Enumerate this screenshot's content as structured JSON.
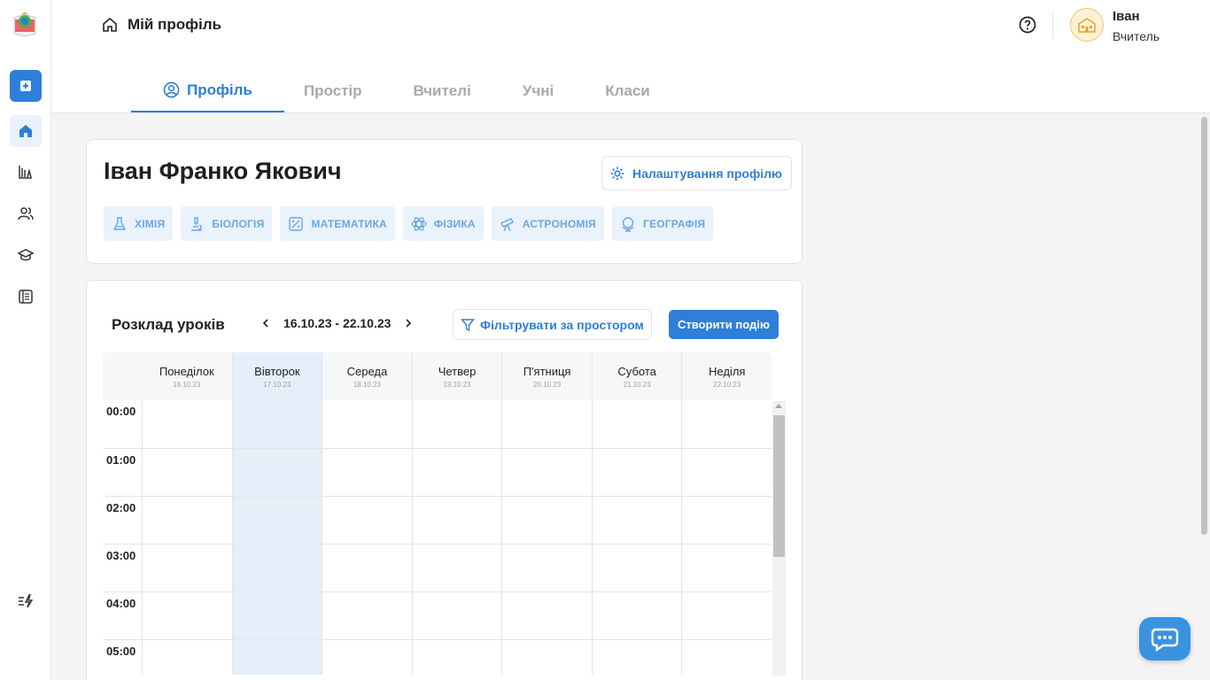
{
  "header": {
    "breadcrumb": "Мій профіль",
    "user": {
      "name": "Іван",
      "role": "Вчитель"
    }
  },
  "tabs": [
    {
      "label": "Профіль",
      "active": true
    },
    {
      "label": "Простір",
      "active": false
    },
    {
      "label": "Вчителі",
      "active": false
    },
    {
      "label": "Учні",
      "active": false
    },
    {
      "label": "Класи",
      "active": false
    }
  ],
  "profile": {
    "full_name": "Іван Франко Якович",
    "settings_label": "Налаштування профілю",
    "subjects": [
      {
        "label": "ХІМІЯ",
        "icon": "flask-icon"
      },
      {
        "label": "БІОЛОГІЯ",
        "icon": "microscope-icon"
      },
      {
        "label": "МАТЕМАТИКА",
        "icon": "percent-icon"
      },
      {
        "label": "ФІЗИКА",
        "icon": "atom-icon"
      },
      {
        "label": "АСТРОНОМІЯ",
        "icon": "telescope-icon"
      },
      {
        "label": "ГЕОГРАФІЯ",
        "icon": "globe-icon"
      }
    ]
  },
  "schedule": {
    "title": "Розклад уроків",
    "range": "16.10.23 - 22.10.23",
    "filter_label": "Фільтрувати за простором",
    "create_label": "Створити подію",
    "days": [
      {
        "name": "Понеділок",
        "date": "16.10.23"
      },
      {
        "name": "Вівторок",
        "date": "17.10.23"
      },
      {
        "name": "Середа",
        "date": "18.10.23"
      },
      {
        "name": "Четвер",
        "date": "19.10.23"
      },
      {
        "name": "П'ятниця",
        "date": "20.10.23"
      },
      {
        "name": "Субота",
        "date": "21.10.23"
      },
      {
        "name": "Неділя",
        "date": "22.10.23"
      }
    ],
    "hours": [
      "00:00",
      "01:00",
      "02:00",
      "03:00",
      "04:00",
      "05:00"
    ]
  },
  "colors": {
    "accent": "#2f7fd8",
    "today_bg": "#e4effa",
    "chip_bg": "#eaf2fb",
    "chip_text": "#6aa6e6"
  }
}
